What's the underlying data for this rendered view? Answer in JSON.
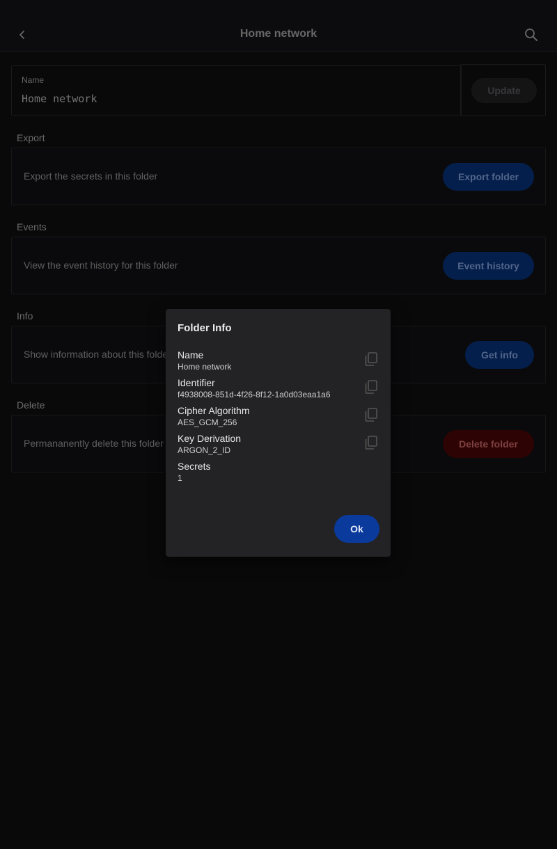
{
  "header": {
    "title": "Home network",
    "back_icon": "chevron-left-icon",
    "search_icon": "search-icon"
  },
  "name_field": {
    "label": "Name",
    "value": "Home network"
  },
  "update_button": {
    "label": "Update"
  },
  "sections": {
    "export": {
      "heading": "Export",
      "description": "Export the secrets in this folder",
      "button": "Export folder"
    },
    "events": {
      "heading": "Events",
      "description": "View the event history for this folder",
      "button": "Event history"
    },
    "info": {
      "heading": "Info",
      "description": "Show information about this folder",
      "button": "Get info"
    },
    "delete": {
      "heading": "Delete",
      "description": "Permananently delete this folder",
      "button": "Delete folder"
    }
  },
  "dialog": {
    "title": "Folder Info",
    "rows": [
      {
        "key": "Name",
        "value": "Home network",
        "copy_icon": "copy-icon"
      },
      {
        "key": "Identifier",
        "value": "f4938008-851d-4f26-8f12-1a0d03eaa1a6",
        "copy_icon": "copy-icon"
      },
      {
        "key": "Cipher Algorithm",
        "value": "AES_GCM_256",
        "copy_icon": "copy-icon"
      },
      {
        "key": "Key Derivation",
        "value": "ARGON_2_ID",
        "copy_icon": "copy-icon"
      },
      {
        "key": "Secrets",
        "value": "1"
      }
    ],
    "ok_button": "Ok"
  },
  "colors": {
    "background": "#0c0c0d",
    "primary_button": "#062a64",
    "danger_button": "#3e0404",
    "dialog_background": "#232325",
    "ok_button": "#0a3a9c"
  }
}
